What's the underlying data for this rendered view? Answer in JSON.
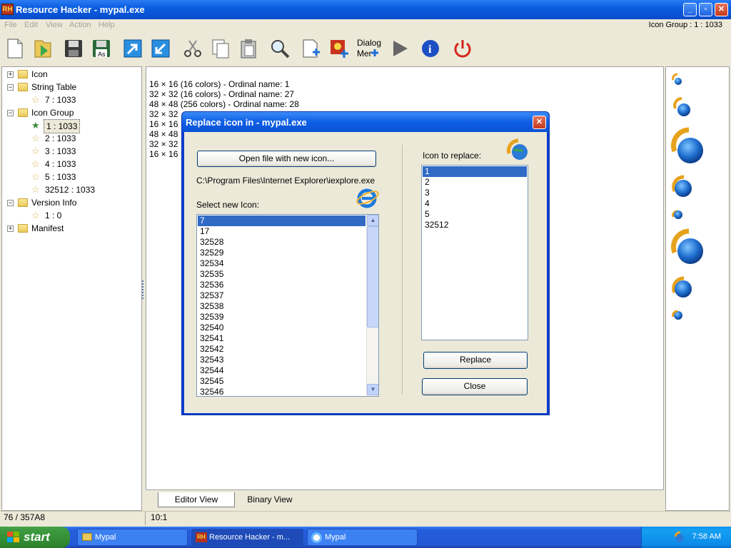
{
  "app": {
    "logo_text": "RH",
    "window_title": "Resource Hacker - mypal.exe",
    "controls": {
      "minimize": "_",
      "maximize": "▫",
      "close": "✕"
    }
  },
  "menu": {
    "items": [
      "File",
      "Edit",
      "View",
      "Action",
      "Help"
    ],
    "status_right": "Icon Group : 1 : 1033"
  },
  "toolbar": {
    "buttons": [
      {
        "name": "new-file-icon"
      },
      {
        "name": "open-file-icon"
      },
      {
        "name": "save-icon"
      },
      {
        "name": "save-as-icon",
        "label": "As"
      },
      {
        "name": "export-icon"
      },
      {
        "name": "import-icon"
      },
      {
        "name": "cut-icon"
      },
      {
        "name": "copy-icon"
      },
      {
        "name": "paste-icon"
      },
      {
        "name": "find-icon"
      },
      {
        "name": "add-resource-icon"
      },
      {
        "name": "add-image-icon"
      },
      {
        "name": "dialog-menu-icon",
        "label": "Dialog\nMenu"
      },
      {
        "name": "run-icon"
      },
      {
        "name": "info-icon"
      },
      {
        "name": "exit-icon"
      }
    ]
  },
  "tree": {
    "nodes": [
      {
        "label": "Icon",
        "type": "folder",
        "level": 0
      },
      {
        "label": "String Table",
        "type": "folder-open",
        "level": 0
      },
      {
        "label": "7 : 1033",
        "type": "leaf",
        "level": 1
      },
      {
        "label": "Icon Group",
        "type": "folder-open",
        "level": 0
      },
      {
        "label": "1 : 1033",
        "type": "leaf-selected",
        "level": 1
      },
      {
        "label": "2 : 1033",
        "type": "leaf",
        "level": 1
      },
      {
        "label": "3 : 1033",
        "type": "leaf",
        "level": 1
      },
      {
        "label": "4 : 1033",
        "type": "leaf",
        "level": 1
      },
      {
        "label": "5 : 1033",
        "type": "leaf",
        "level": 1
      },
      {
        "label": "32512 : 1033",
        "type": "leaf",
        "level": 1
      },
      {
        "label": "Version Info",
        "type": "folder-open",
        "level": 0
      },
      {
        "label": "1 : 0",
        "type": "leaf",
        "level": 1
      },
      {
        "label": "Manifest",
        "type": "folder",
        "level": 0
      }
    ]
  },
  "content": {
    "lines": [
      "16 × 16 (16 colors) - Ordinal name: 1",
      "32 × 32 (16 colors) - Ordinal name: 27",
      "48 × 48 (256 colors) - Ordinal name: 28",
      "32 × 32",
      "16 × 16",
      "48 × 48",
      "32 × 32",
      "16 × 16"
    ]
  },
  "tabs": {
    "editor": "Editor View",
    "binary": "Binary View"
  },
  "status": {
    "left": "76 / 357A8",
    "mid": "10:1"
  },
  "dialog": {
    "title": "Replace icon in - mypal.exe",
    "open_button": "Open file with new icon...",
    "file_path": "C:\\Program Files\\Internet Explorer\\iexplore.exe",
    "select_label": "Select new Icon:",
    "new_icons": [
      "7",
      "17",
      "32528",
      "32529",
      "32534",
      "32535",
      "32536",
      "32537",
      "32538",
      "32539",
      "32540",
      "32541",
      "32542",
      "32543",
      "32544",
      "32545",
      "32546"
    ],
    "selected_new_icon": "7",
    "replace_label": "Icon to replace:",
    "replace_icons": [
      "1",
      "2",
      "3",
      "4",
      "5",
      "32512"
    ],
    "selected_replace_icon": "1",
    "replace_button": "Replace",
    "close_button": "Close"
  },
  "taskbar": {
    "start": "start",
    "tasks": [
      {
        "label": "Mypal",
        "icon": "folder-icon"
      },
      {
        "label": "Resource Hacker - m...",
        "icon": "resource-hacker-icon",
        "active": true
      },
      {
        "label": "Mypal",
        "icon": "browser-icon"
      }
    ],
    "clock": "7:58 AM"
  },
  "colors": {
    "accent": "#0a5ee0",
    "selection": "#316ac5",
    "window_bg": "#ece9d8",
    "taskbar": "#245edc",
    "start_green": "#3c9a3f"
  }
}
